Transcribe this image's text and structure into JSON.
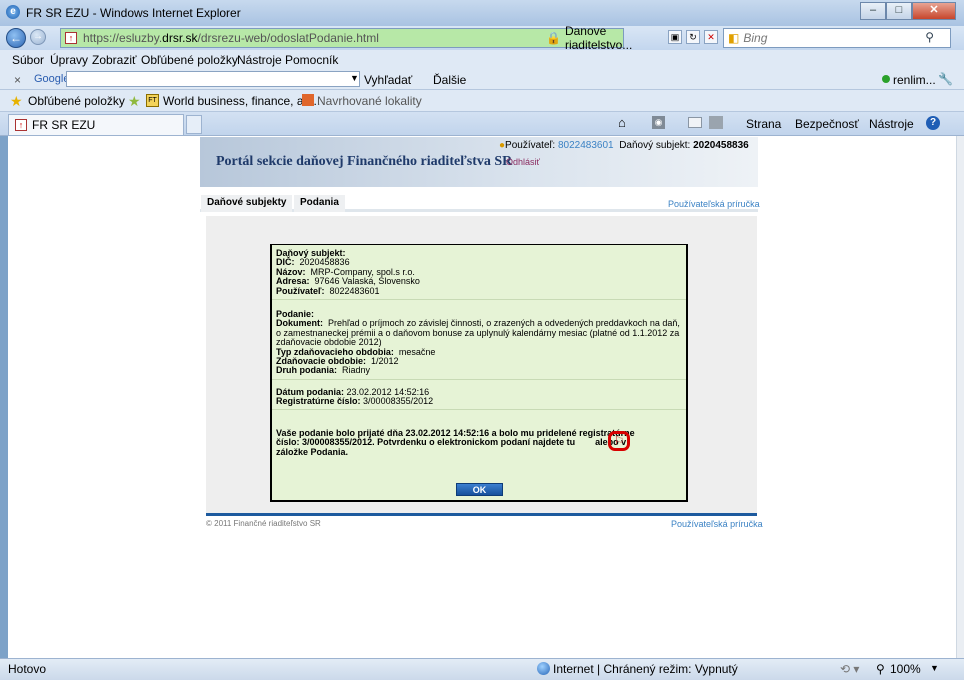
{
  "window": {
    "title": "FR SR EZU - Windows Internet Explorer",
    "btn_min": "–",
    "btn_max": "□",
    "btn_close": "✕"
  },
  "address": {
    "url_pre": "https://esluzby.",
    "url_host": "drsr.sk",
    "url_path": "/drsrezu-web/odoslatPodanie.html",
    "cert": "Danove riaditelstvo...",
    "search_placeholder": "Bing"
  },
  "menu": [
    "Súbor",
    "Úpravy",
    "Zobraziť",
    "Obľúbené položky",
    "Nástroje",
    "Pomocník"
  ],
  "google_toolbar": {
    "close": "×",
    "logo": "Google",
    "search_btn": "Vyhľadať",
    "more": "Ďalšie",
    "user": "renlim..."
  },
  "favorites": {
    "label": "Obľúbené položky",
    "items": [
      "World business, finance, an...",
      "Navrhované lokality"
    ]
  },
  "tab": {
    "title": "FR SR EZU"
  },
  "command_bar": {
    "strana": "Strana",
    "bezpecnost": "Bezpečnosť",
    "nastroje": "Nástroje"
  },
  "portal": {
    "title": "Portál sekcie daňovej Finančného riaditeľstva SR",
    "user_label": "Používateľ:",
    "user_value": "8022483601",
    "subject_label": "Daňový subjekt:",
    "subject_value": "2020458836",
    "logout": "Odhlásiť",
    "tabs": [
      "Daňové subjekty",
      "Podania"
    ],
    "guide": "Používateľská príručka",
    "footer": "© 2011 Finančné riaditeľstvo SR"
  },
  "dialog": {
    "subject_header": "Daňový subjekt:",
    "dic_label": "DIČ:",
    "dic": "2020458836",
    "name_label": "Názov:",
    "name": "MRP-Company, spol.s r.o.",
    "address_label": "Adresa:",
    "address": "97646 Valaská, Slovensko",
    "user_label": "Používateľ:",
    "user": "8022483601",
    "filing_header": "Podanie:",
    "doc_label": "Dokument:",
    "doc": "Prehľad o príjmoch zo závislej činnosti, o zrazených a odvedených preddavkoch na daň, o zamestnaneckej prémii a o daňovom bonuse za uplynulý kalendárny mesiac (platné od 1.1.2012 za zdaňovacie obdobie 2012)",
    "period_type_label": "Typ zdaňovacieho obdobia:",
    "period_type": "mesačne",
    "period_label": "Zdaňovacie obdobie:",
    "period": "1/2012",
    "kind_label": "Druh podania:",
    "kind": "Riadny",
    "date_label": "Dátum podania:",
    "date": "23.02.2012 14:52:16",
    "reg_label": "Registratúrne číslo:",
    "reg": "3/00008355/2012",
    "message_1": "Vaše podanie bolo prijaté dňa 23.02.2012 14:52:16  a bolo mu pridelené registratúrne",
    "message_2a": "číslo: 3/00008355/2012. Potvrdenku o elektronickom podaní najdete tu",
    "message_2b": "alebo v",
    "message_3": "záložke Podania.",
    "ok": "OK"
  },
  "status": {
    "text": "Hotovo",
    "zone": "Internet | Chránený režim: Vypnutý",
    "zoom": "100%"
  }
}
